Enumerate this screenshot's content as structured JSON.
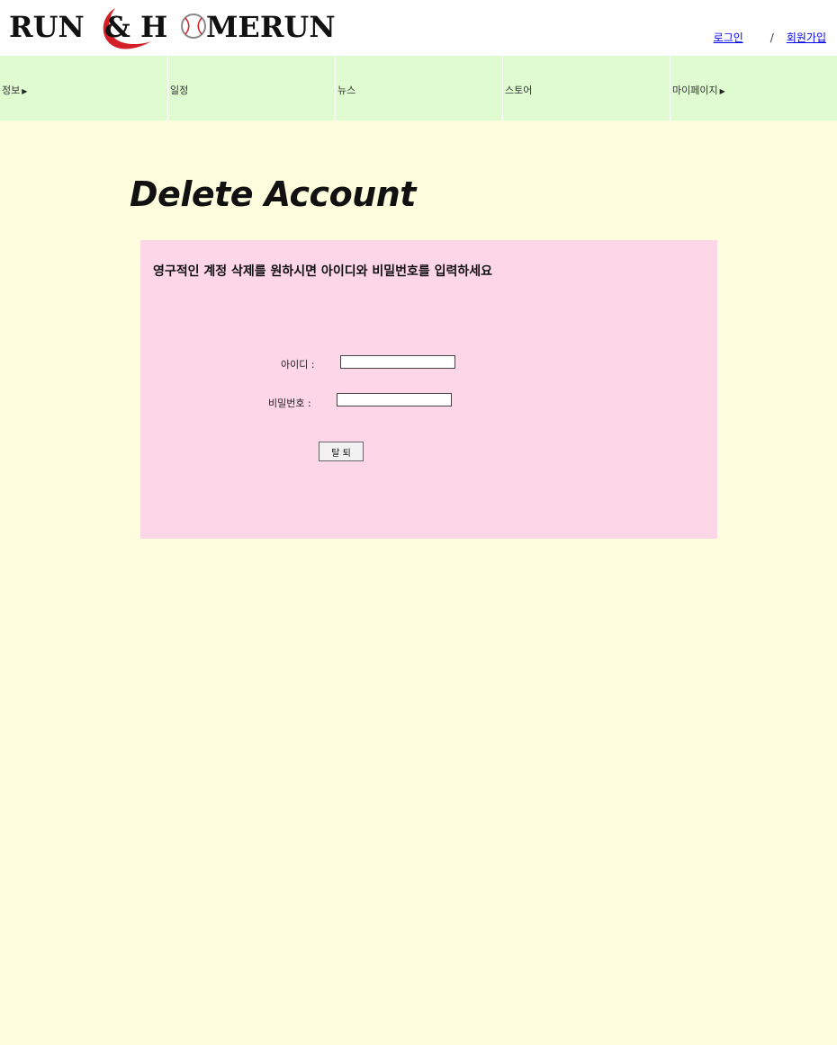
{
  "header": {
    "logo_text": "RUN& H MERUN",
    "logo_icon": "baseball-icon",
    "login_label": "로그인",
    "separator": "/",
    "signup_label": "회원가입"
  },
  "nav": {
    "items": [
      {
        "label": "정보",
        "has_caret": true
      },
      {
        "label": "일정",
        "has_caret": false
      },
      {
        "label": "뉴스",
        "has_caret": false
      },
      {
        "label": "스토어",
        "has_caret": false
      },
      {
        "label": "마이페이지",
        "has_caret": true
      }
    ],
    "caret_icon": "caret-right-icon"
  },
  "main": {
    "title": "Delete Account",
    "panel": {
      "message": "영구적인 계정 삭제를 원하시면 아이디와 비밀번호를 입력하세요",
      "id_label": "아이디 :",
      "id_value": "",
      "password_label": "비밀번호 :",
      "password_value": "",
      "submit_label": "탈 퇴"
    }
  },
  "colors": {
    "nav_bg": "#dffcd0",
    "main_bg": "#fefedf",
    "panel_bg": "#fdd6e8",
    "logo_accent": "#d31f26"
  }
}
